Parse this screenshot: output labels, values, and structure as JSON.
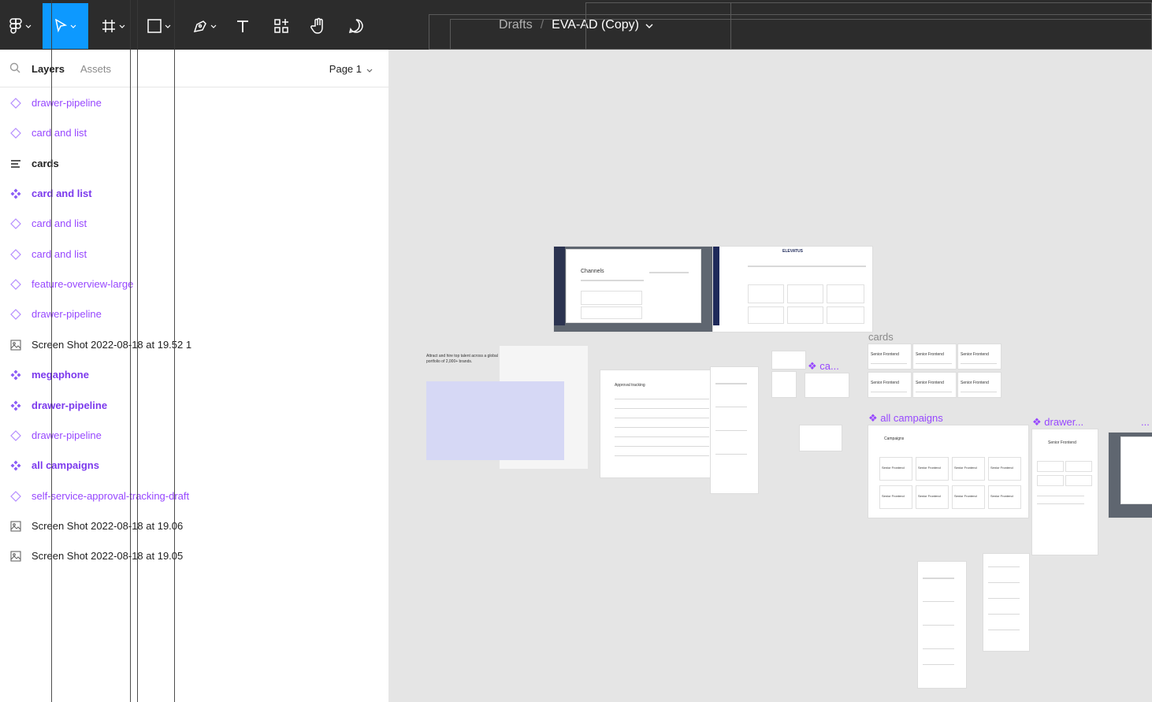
{
  "toolbar": {
    "breadcrumb_drafts": "Drafts",
    "breadcrumb_separator": "/",
    "file_name": "EVA-AD (Copy)",
    "accent_color": "#0d99ff"
  },
  "panel": {
    "tab_layers": "Layers",
    "tab_assets": "Assets",
    "page": "Page 1"
  },
  "layers": [
    {
      "label": "drawer-pipeline",
      "icon": "component-instance-icon",
      "style": "purple"
    },
    {
      "label": "card and list",
      "icon": "component-instance-icon",
      "style": "purple"
    },
    {
      "label": "cards",
      "icon": "auto-layout-icon",
      "style": "dark-b"
    },
    {
      "label": "card and list",
      "icon": "component-icon",
      "style": "purple-b"
    },
    {
      "label": "card and list",
      "icon": "component-instance-icon",
      "style": "purple"
    },
    {
      "label": "card and list",
      "icon": "component-instance-icon",
      "style": "purple"
    },
    {
      "label": "feature-overview-large",
      "icon": "component-instance-icon",
      "style": "purple"
    },
    {
      "label": "drawer-pipeline",
      "icon": "component-instance-icon",
      "style": "purple"
    },
    {
      "label": "Screen Shot 2022-08-18 at 19.52 1",
      "icon": "image-icon",
      "style": "dark"
    },
    {
      "label": "megaphone",
      "icon": "component-icon",
      "style": "purple-b"
    },
    {
      "label": "drawer-pipeline",
      "icon": "component-icon",
      "style": "purple-b"
    },
    {
      "label": "drawer-pipeline",
      "icon": "component-instance-icon",
      "style": "purple"
    },
    {
      "label": "all campaigns",
      "icon": "component-icon",
      "style": "purple-b"
    },
    {
      "label": "self-service-approval-tracking-draft",
      "icon": "component-instance-icon",
      "style": "purple"
    },
    {
      "label": "Screen Shot 2022-08-18 at 19.06",
      "icon": "image-icon",
      "style": "dark"
    },
    {
      "label": "Screen Shot 2022-08-18 at 19.05",
      "icon": "image-icon",
      "style": "dark"
    }
  ],
  "canvas": {
    "label_ca": "ca...",
    "label_cards": "cards",
    "label_all_campaigns": "all campaigns",
    "label_drawer": "drawer...",
    "label_more": "...",
    "hero_text": "Attract and hire top talent across a global portfolio of 2,000+ brands.",
    "screenshot_channels": "Channels",
    "screenshot_brand": "ELEVATUS",
    "card_title": "Senior Frontend",
    "approval_title": "Approval tracking",
    "campaigns_title": "Campaigns"
  }
}
